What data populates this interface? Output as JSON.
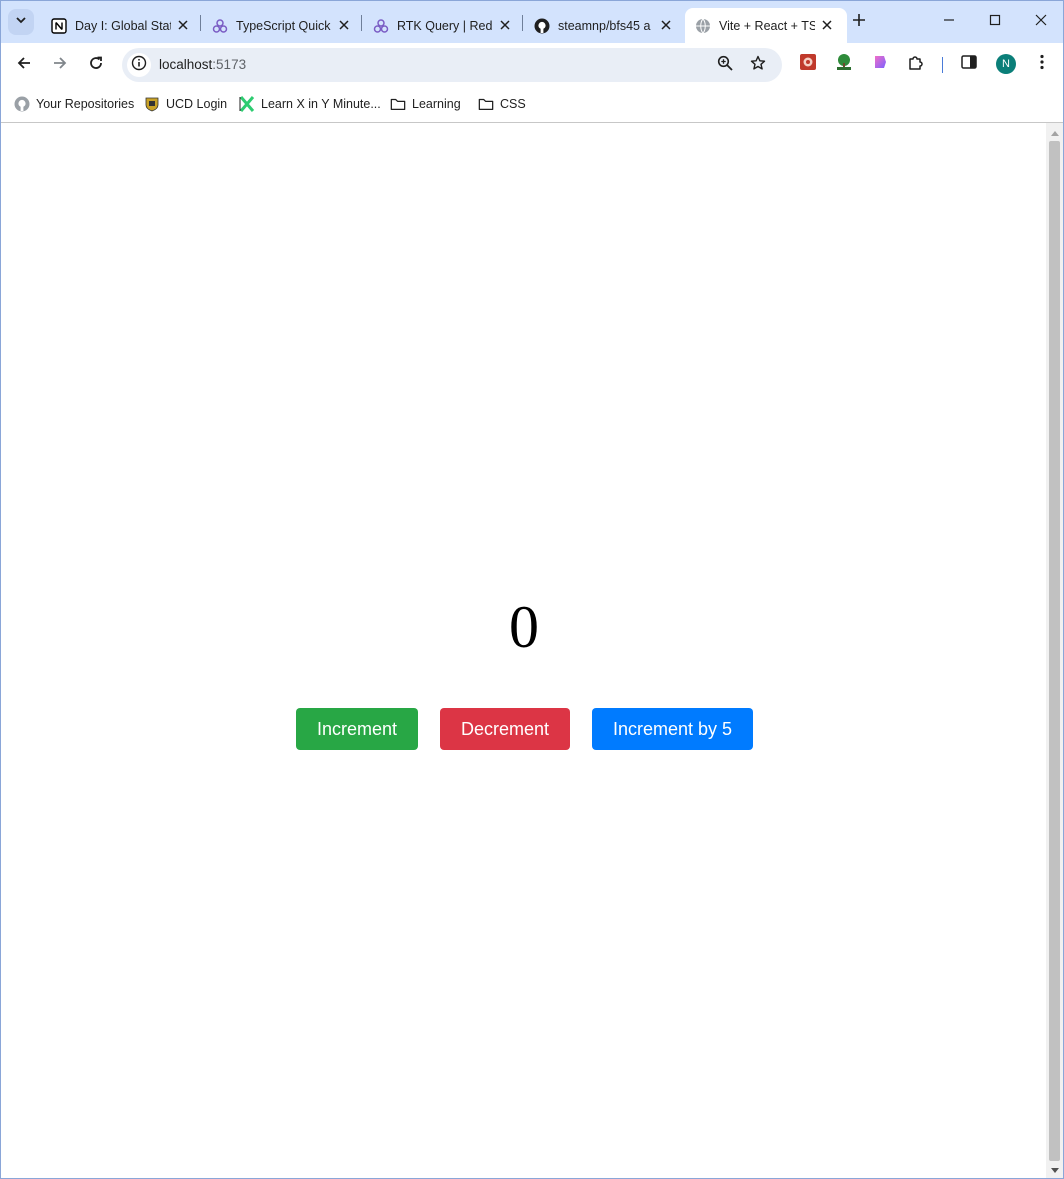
{
  "tabs": [
    {
      "title": "Day I: Global Stat",
      "icon": "notion-icon",
      "active": false
    },
    {
      "title": "TypeScript Quick",
      "icon": "redux-icon",
      "active": false
    },
    {
      "title": "RTK Query | Redu",
      "icon": "redux-icon",
      "active": false
    },
    {
      "title": "steamnp/bfs45 a",
      "icon": "github-icon",
      "active": false
    },
    {
      "title": "Vite + React + TS",
      "icon": "globe-icon",
      "active": true
    }
  ],
  "address_bar": {
    "host": "localhost",
    "port": ":5173"
  },
  "profile": {
    "initial": "N"
  },
  "bookmarks": [
    {
      "label": "Your Repositories",
      "icon": "github-icon"
    },
    {
      "label": "UCD Login",
      "icon": "ucd-icon"
    },
    {
      "label": "Learn X in Y Minute...",
      "icon": "x-icon"
    },
    {
      "label": "Learning",
      "icon": "folder-icon"
    },
    {
      "label": "CSS",
      "icon": "folder-icon"
    }
  ],
  "page": {
    "counter_value": "0",
    "buttons": {
      "increment": "Increment",
      "decrement": "Decrement",
      "increment_by_5": "Increment by 5"
    }
  },
  "colors": {
    "increment": "#28a745",
    "decrement": "#dc3545",
    "increment_by_5": "#007bff",
    "tabstrip": "#d3e3fd"
  }
}
